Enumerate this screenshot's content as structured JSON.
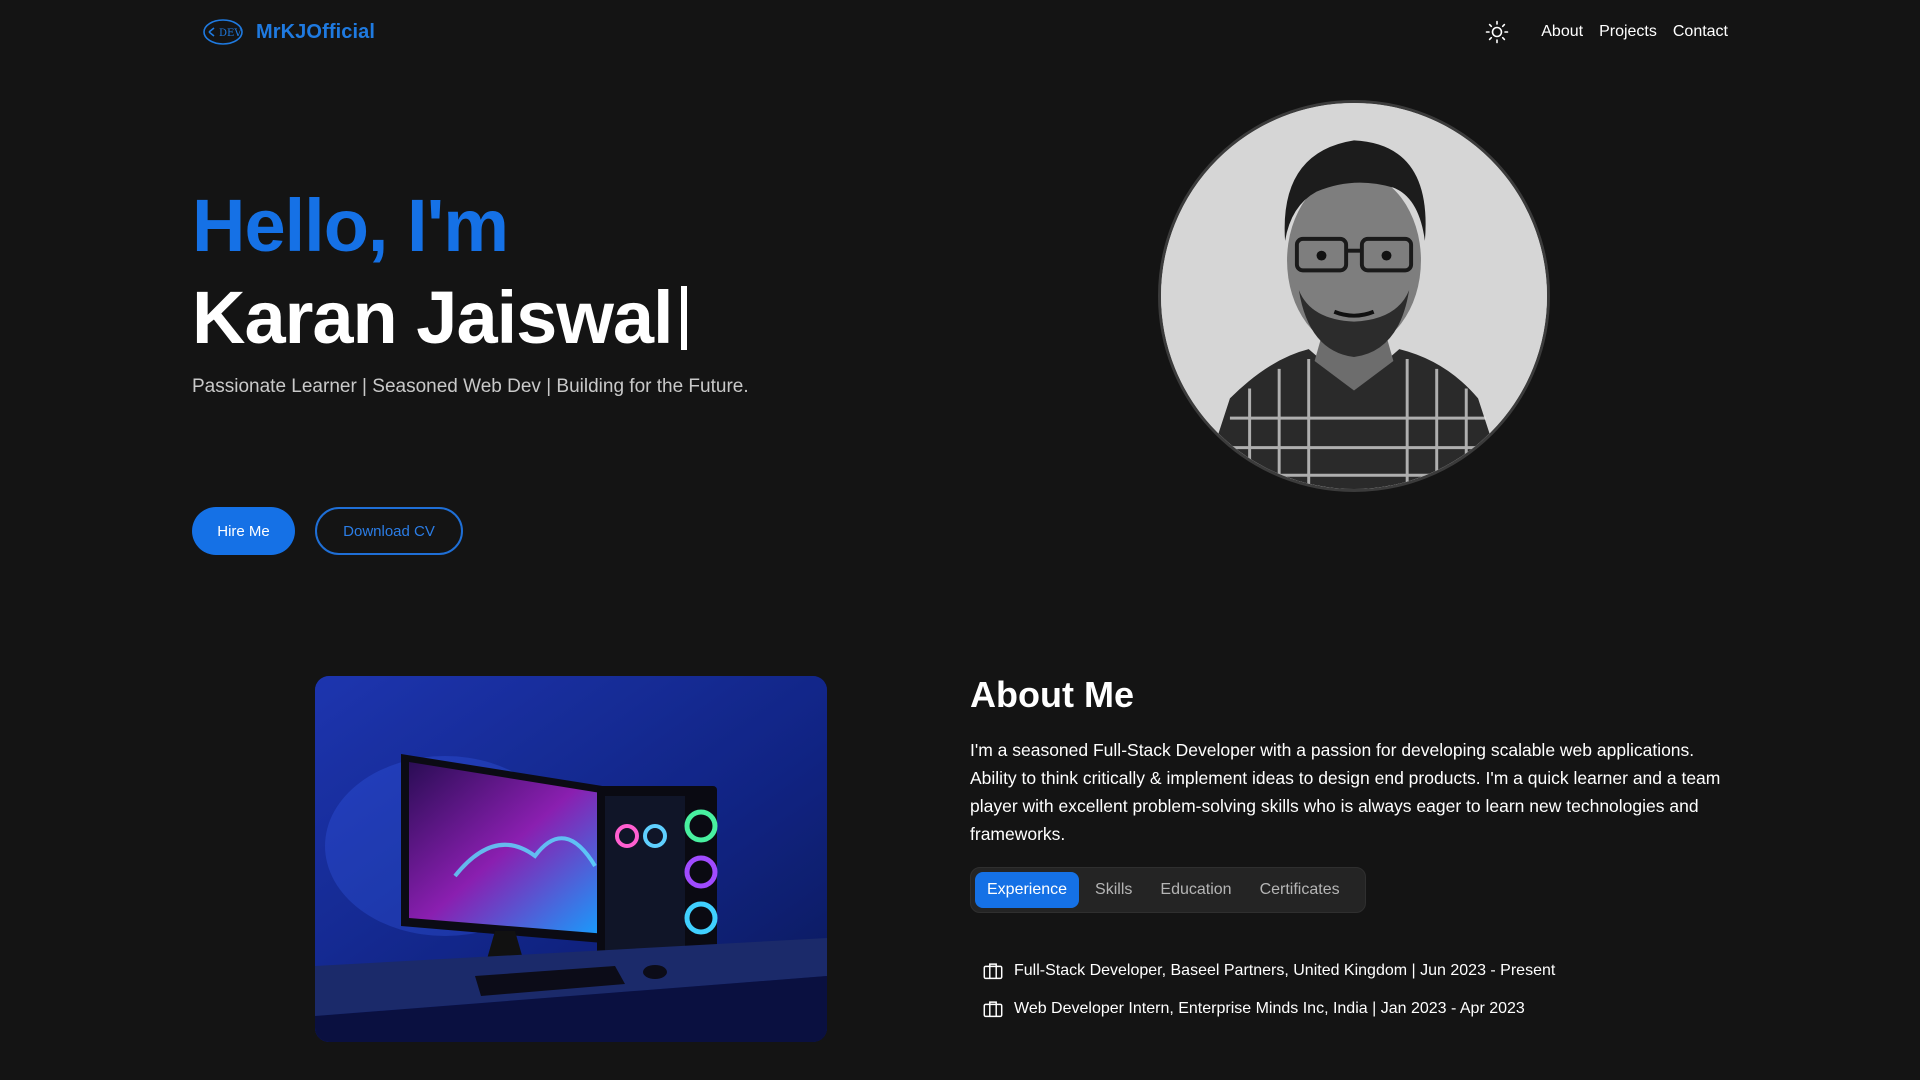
{
  "header": {
    "logo_text": "MrKJOfficial",
    "logo_icon": "dev-logo-icon",
    "theme_icon": "sun-icon",
    "nav": [
      "About",
      "Projects",
      "Contact"
    ]
  },
  "hero": {
    "greeting": "Hello, I'm",
    "name": "Karan Jaiswal",
    "tagline": "Passionate Learner | Seasoned Web Dev | Building for the Future.",
    "hire_label": "Hire Me",
    "download_label": "Download CV"
  },
  "about": {
    "title": "About Me",
    "text": "I'm a seasoned Full-Stack Developer with a passion for developing scalable web applications. Ability to think critically & implement ideas to design end products. I'm a quick learner and a team player with excellent problem-solving skills who is always eager to learn new technologies and frameworks.",
    "tabs": [
      "Experience",
      "Skills",
      "Education",
      "Certificates"
    ],
    "active_tab": "Experience",
    "experience": [
      "Full-Stack Developer, Baseel Partners, United Kingdom | Jun 2023 - Present",
      "Web Developer Intern, Enterprise Minds Inc, India | Jan 2023 - Apr 2023"
    ],
    "experience_icon": "briefcase-icon"
  },
  "colors": {
    "background": "#141414",
    "accent": "#1571e6",
    "text": "#ffffff",
    "muted": "#c9c9c9"
  }
}
